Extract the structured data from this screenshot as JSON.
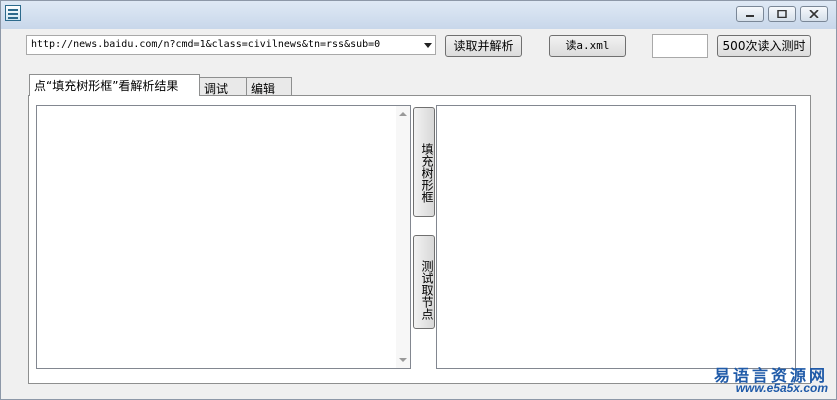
{
  "toolbar": {
    "url_value": "http://news.baidu.com/n?cmd=1&class=civilnews&tn=rss&sub=0",
    "read_parse_label": "读取并解析",
    "read_xml_label": "读a.xml",
    "count_value": "",
    "timing_label": "500次读入测时"
  },
  "tabs": [
    {
      "label": "点“填充树形框”看解析结果"
    },
    {
      "label": "调试"
    },
    {
      "label": "编辑"
    }
  ],
  "panel": {
    "fill_tree_label": "填充树形框",
    "test_node_label": "测试取节点"
  },
  "watermark": {
    "name": "易语言资源网",
    "url": "www.e5a5x.com"
  }
}
